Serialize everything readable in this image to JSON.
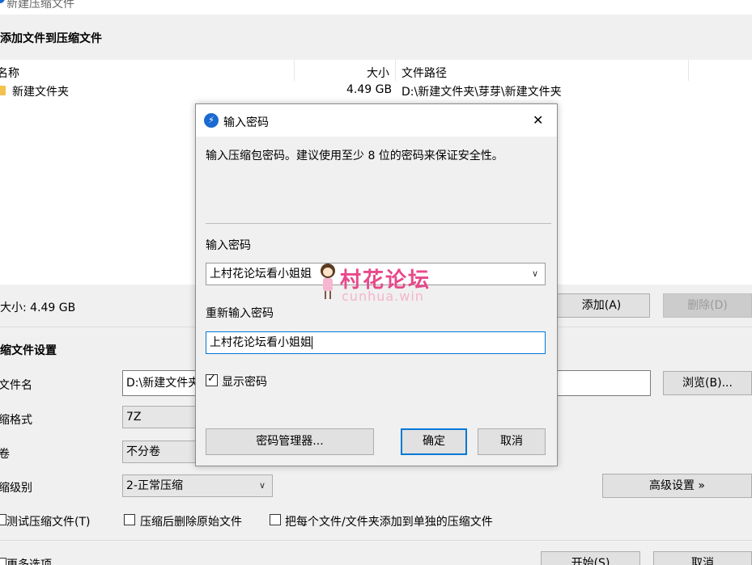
{
  "window": {
    "title": "新建压缩文件"
  },
  "add_section": {
    "title": "添加文件到压缩文件"
  },
  "file_list": {
    "headers": {
      "name": "名称",
      "size": "大小",
      "path": "文件路径"
    },
    "rows": [
      {
        "name": "新建文件夹",
        "size": "4.49 GB",
        "path": "D:\\新建文件夹\\芽芽\\新建文件夹"
      }
    ]
  },
  "total_size": "大小: 4.49 GB",
  "buttons": {
    "add": "添加(A)",
    "delete": "删除(D)",
    "browse": "浏览(B)...",
    "advanced": "高级设置 »",
    "start": "开始(S)",
    "cancel_main": "取消"
  },
  "settings": {
    "title": "缩文件设置",
    "filename_label": "文件名",
    "filename_value": "D:\\新建文件夹",
    "format_label": "缩格式",
    "format_value": "7Z",
    "volume_label": "卷",
    "volume_value": "不分卷",
    "level_label": "缩级别",
    "level_value": "2-正常压缩",
    "test_label": "测试压缩文件(T)",
    "delete_after_label": "压缩后删除原始文件",
    "each_label": "把每个文件/文件夹添加到单独的压缩文件",
    "more_options": "更多选项"
  },
  "dialog": {
    "title": "输入密码",
    "description": "输入压缩包密码。建议使用至少 8 位的密码来保证安全性。",
    "password_label": "输入密码",
    "password_value": "上村花论坛看小姐姐",
    "confirm_label": "重新输入密码",
    "confirm_value": "上村花论坛看小姐姐",
    "show_password_label": "显示密码",
    "show_password_checked": true,
    "manager_button": "密码管理器...",
    "ok_button": "确定",
    "cancel_button": "取消",
    "close_glyph": "✕"
  },
  "watermark": {
    "cn": "村花论坛",
    "en": "cunhua.win"
  },
  "colors": {
    "accent": "#1b6ad1",
    "focus_border": "#0078d7",
    "watermark": "#e8488a"
  },
  "icons": {
    "folder": "folder-icon",
    "app": "app-logo-icon",
    "close": "close-icon",
    "chevron": "chevron-down-icon",
    "check": "checkmark-icon"
  }
}
